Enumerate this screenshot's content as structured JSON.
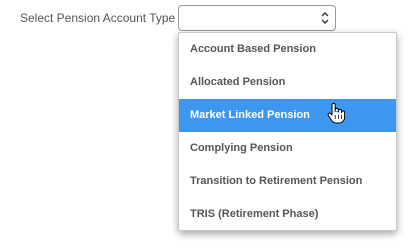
{
  "form": {
    "label": "Select Pension Account Type",
    "select": {
      "value": "",
      "caret_icon": "up-down-caret-icon"
    }
  },
  "dropdown": {
    "options": [
      {
        "label": "Account Based Pension",
        "selected": false
      },
      {
        "label": "Allocated Pension",
        "selected": false
      },
      {
        "label": "Market Linked Pension",
        "selected": true
      },
      {
        "label": "Complying Pension",
        "selected": false
      },
      {
        "label": "Transition to Retirement Pension",
        "selected": false
      },
      {
        "label": "TRIS (Retirement Phase)",
        "selected": false
      }
    ],
    "highlight_color": "#3d97f0"
  },
  "cursor": {
    "icon": "hand-pointer-icon"
  }
}
